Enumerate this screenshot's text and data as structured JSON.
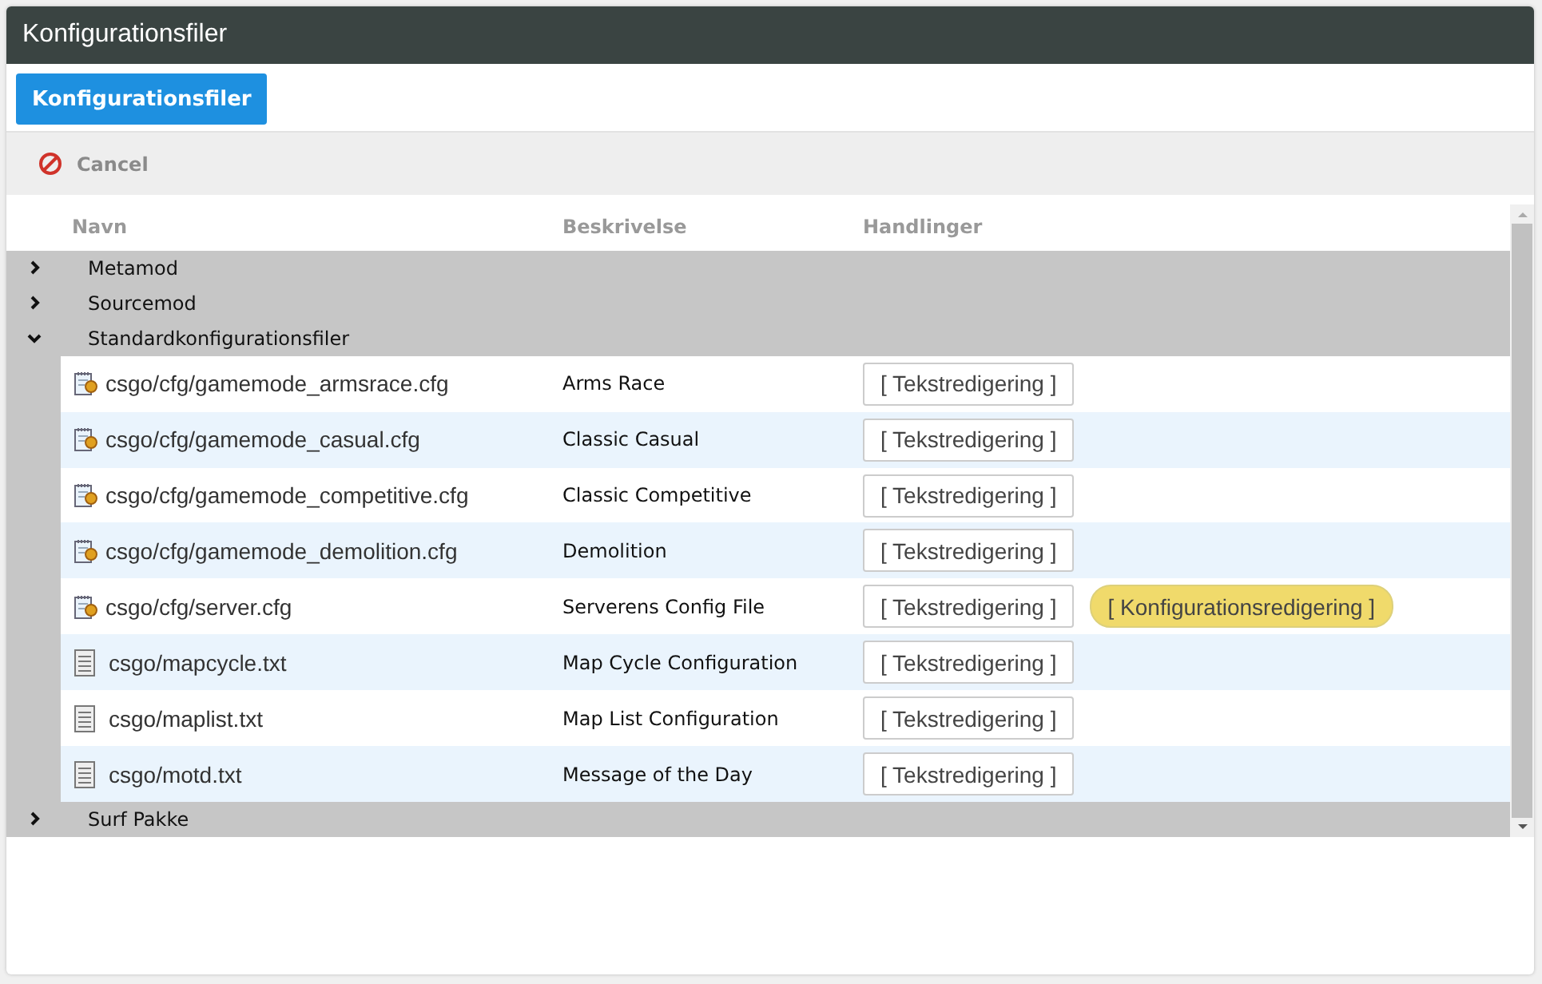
{
  "window": {
    "title": "Konfigurationsfiler"
  },
  "tabs": [
    {
      "label": "Konfigurationsfiler",
      "selected": true
    }
  ],
  "toolbar": {
    "cancel": "Cancel"
  },
  "table": {
    "columns": [
      "Navn",
      "Beskrivelse",
      "Handlinger"
    ],
    "groups": [
      {
        "name": "Metamod",
        "expanded": false
      },
      {
        "name": "Sourcemod",
        "expanded": false
      },
      {
        "name": "Standardkonfigurationsfiler",
        "expanded": true,
        "children": [
          {
            "kind": "cfg",
            "name": "csgo/cfg/gamemode_armsrace.cfg",
            "description": "Arms Race",
            "actions": [
              {
                "kind": "text",
                "label": "[ Tekstredigering ]"
              }
            ]
          },
          {
            "kind": "cfg",
            "name": "csgo/cfg/gamemode_casual.cfg",
            "description": "Classic Casual",
            "actions": [
              {
                "kind": "text",
                "label": "[ Tekstredigering ]"
              }
            ]
          },
          {
            "kind": "cfg",
            "name": "csgo/cfg/gamemode_competitive.cfg",
            "description": "Classic Competitive",
            "actions": [
              {
                "kind": "text",
                "label": "[ Tekstredigering ]"
              }
            ]
          },
          {
            "kind": "cfg",
            "name": "csgo/cfg/gamemode_demolition.cfg",
            "description": "Demolition",
            "actions": [
              {
                "kind": "text",
                "label": "[ Tekstredigering ]"
              }
            ]
          },
          {
            "kind": "cfg",
            "name": "csgo/cfg/server.cfg",
            "description": "Serverens Config File",
            "actions": [
              {
                "kind": "text",
                "label": "[ Tekstredigering ]"
              },
              {
                "kind": "config",
                "label": "[ Konfigurationsredigering ]"
              }
            ]
          },
          {
            "kind": "txt",
            "name": "csgo/mapcycle.txt",
            "description": "Map Cycle Configuration",
            "actions": [
              {
                "kind": "text",
                "label": "[ Tekstredigering ]"
              }
            ]
          },
          {
            "kind": "txt",
            "name": "csgo/maplist.txt",
            "description": "Map List Configuration",
            "actions": [
              {
                "kind": "text",
                "label": "[ Tekstredigering ]"
              }
            ]
          },
          {
            "kind": "txt",
            "name": "csgo/motd.txt",
            "description": "Message of the Day",
            "actions": [
              {
                "kind": "text",
                "label": "[ Tekstredigering ]"
              }
            ]
          }
        ]
      },
      {
        "name": "Surf Pakke",
        "expanded": false
      }
    ]
  }
}
